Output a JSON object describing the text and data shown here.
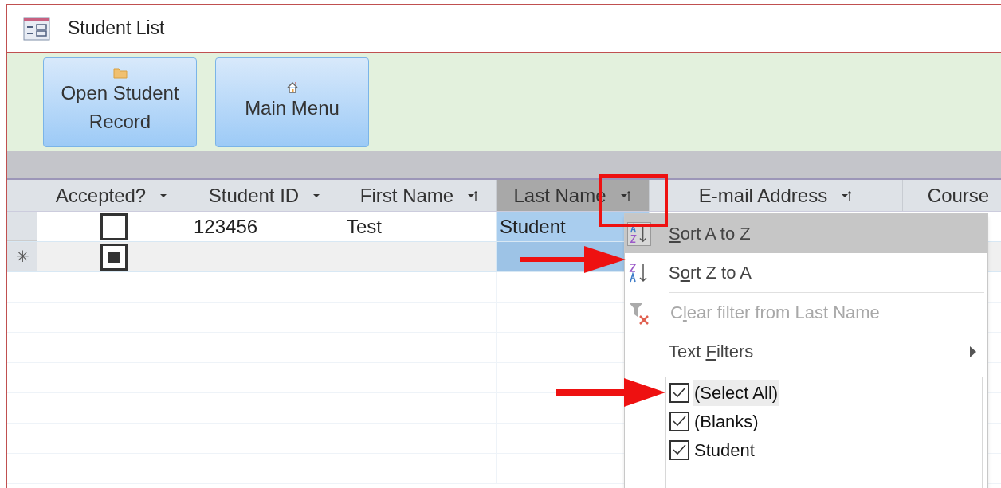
{
  "window": {
    "title": "Student List"
  },
  "buttons": [
    {
      "label_lines": [
        "Open Student",
        "Record"
      ],
      "kind": "folder"
    },
    {
      "label_lines": [
        "Main Menu"
      ],
      "kind": "home"
    }
  ],
  "table": {
    "columns": [
      {
        "label": "Accepted?",
        "sorted": false,
        "selected": false
      },
      {
        "label": "Student ID",
        "sorted": false,
        "selected": false
      },
      {
        "label": "First Name",
        "sorted": true,
        "selected": false
      },
      {
        "label": "Last Name",
        "sorted": true,
        "selected": true
      },
      {
        "label": "E-mail Address",
        "sorted": true,
        "selected": false
      },
      {
        "label": "Course",
        "selected": false
      }
    ],
    "rows": [
      {
        "new_record": false,
        "cells": [
          {
            "kind": "checkbox",
            "checked": false,
            "null_value": false
          },
          "123456",
          "Test",
          "Student"
        ]
      },
      {
        "new_record": true,
        "marker": "✳",
        "cells": [
          {
            "kind": "checkbox",
            "null_value": true
          },
          "",
          "",
          ""
        ]
      }
    ]
  },
  "filter_menu": {
    "items": [
      {
        "kind": "sort_asc",
        "key": "S",
        "after": "ort A to Z",
        "selected": true,
        "disabled": false
      },
      {
        "kind": "sort_desc",
        "before": "S",
        "key": "o",
        "after": "rt Z to A",
        "selected": false,
        "disabled": false
      },
      {
        "kind": "clear_filter",
        "before": "C",
        "key": "l",
        "after": "ear filter from Last Name",
        "selected": false,
        "disabled": true
      },
      {
        "kind": "submenu",
        "before": "Text ",
        "key": "F",
        "after": "ilters",
        "selected": false,
        "disabled": false
      }
    ],
    "values": [
      {
        "label": "(Select All)",
        "checked": true,
        "selected": true
      },
      {
        "label": "(Blanks)",
        "checked": true,
        "selected": false
      },
      {
        "label": "Student",
        "checked": true,
        "selected": false
      }
    ]
  }
}
